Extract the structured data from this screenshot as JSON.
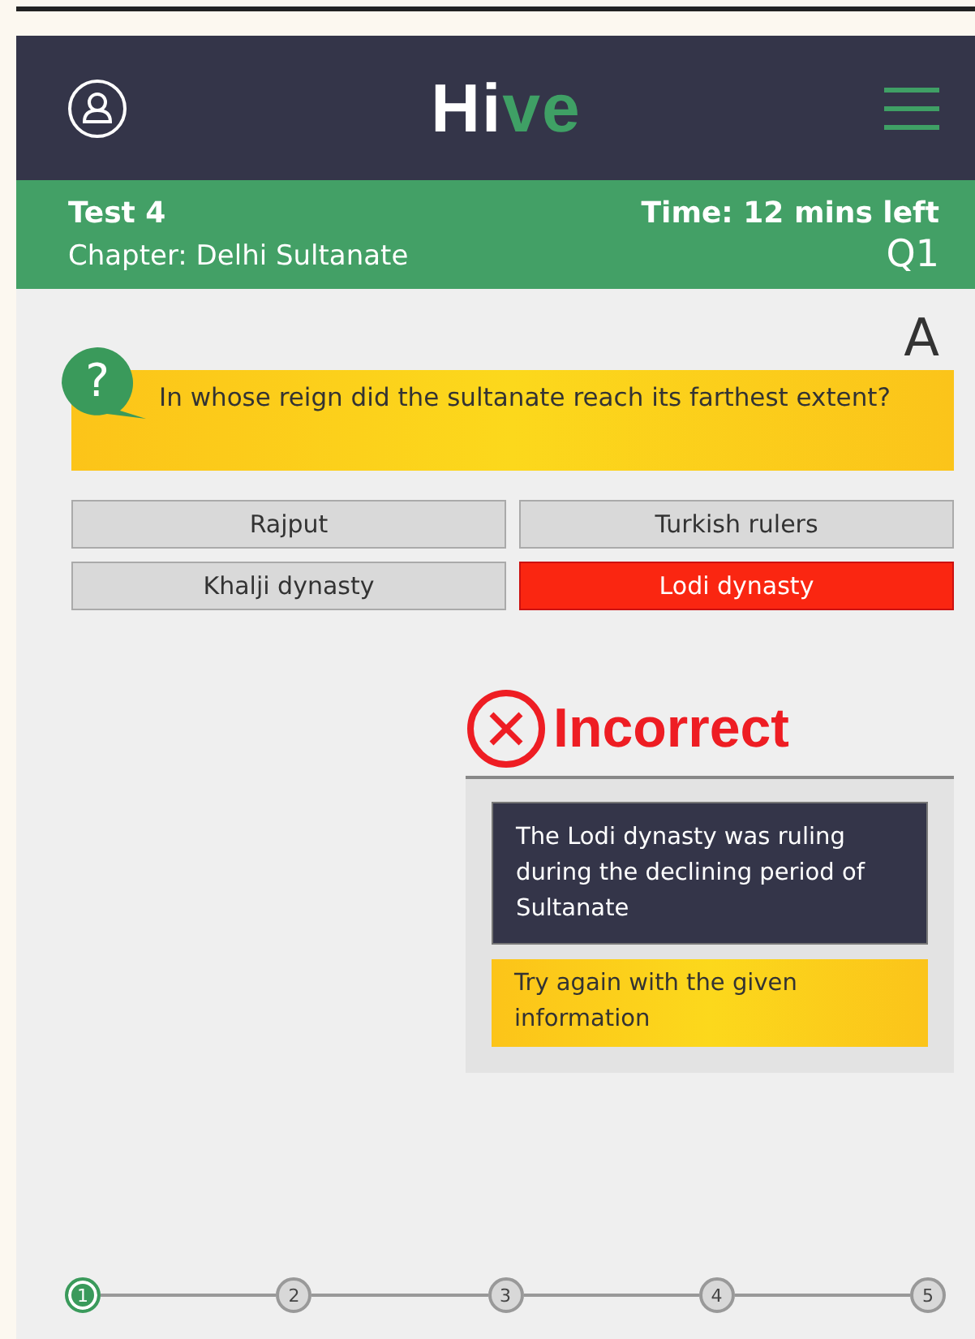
{
  "header": {
    "logo": [
      {
        "text": "Hi",
        "accent": false
      },
      {
        "text": "ve",
        "accent": true
      }
    ]
  },
  "test_bar": {
    "title": "Test 4",
    "chapter": "Chapter: Delhi Sultanate",
    "timer": "Time: 12 mins left",
    "question_number": "Q1"
  },
  "question": {
    "marker": "?",
    "corner_label": "A",
    "text": "In whose reign did the sultanate reach its farthest extent?"
  },
  "options": [
    {
      "label": "Rajput",
      "selected": false
    },
    {
      "label": "Turkish rulers",
      "selected": false
    },
    {
      "label": "Khalji dynasty",
      "selected": false
    },
    {
      "label": "Lodi dynasty",
      "selected": true
    }
  ],
  "feedback": {
    "result": "Incorrect",
    "explanation": "The Lodi dynasty was ruling during the declining period of Sultanate",
    "hint": "Try again with the given information"
  },
  "steps": [
    {
      "label": "1",
      "selected": true
    },
    {
      "label": "2",
      "selected": false
    },
    {
      "label": "3",
      "selected": false
    },
    {
      "label": "4",
      "selected": false
    },
    {
      "label": "5",
      "selected": false
    }
  ]
}
